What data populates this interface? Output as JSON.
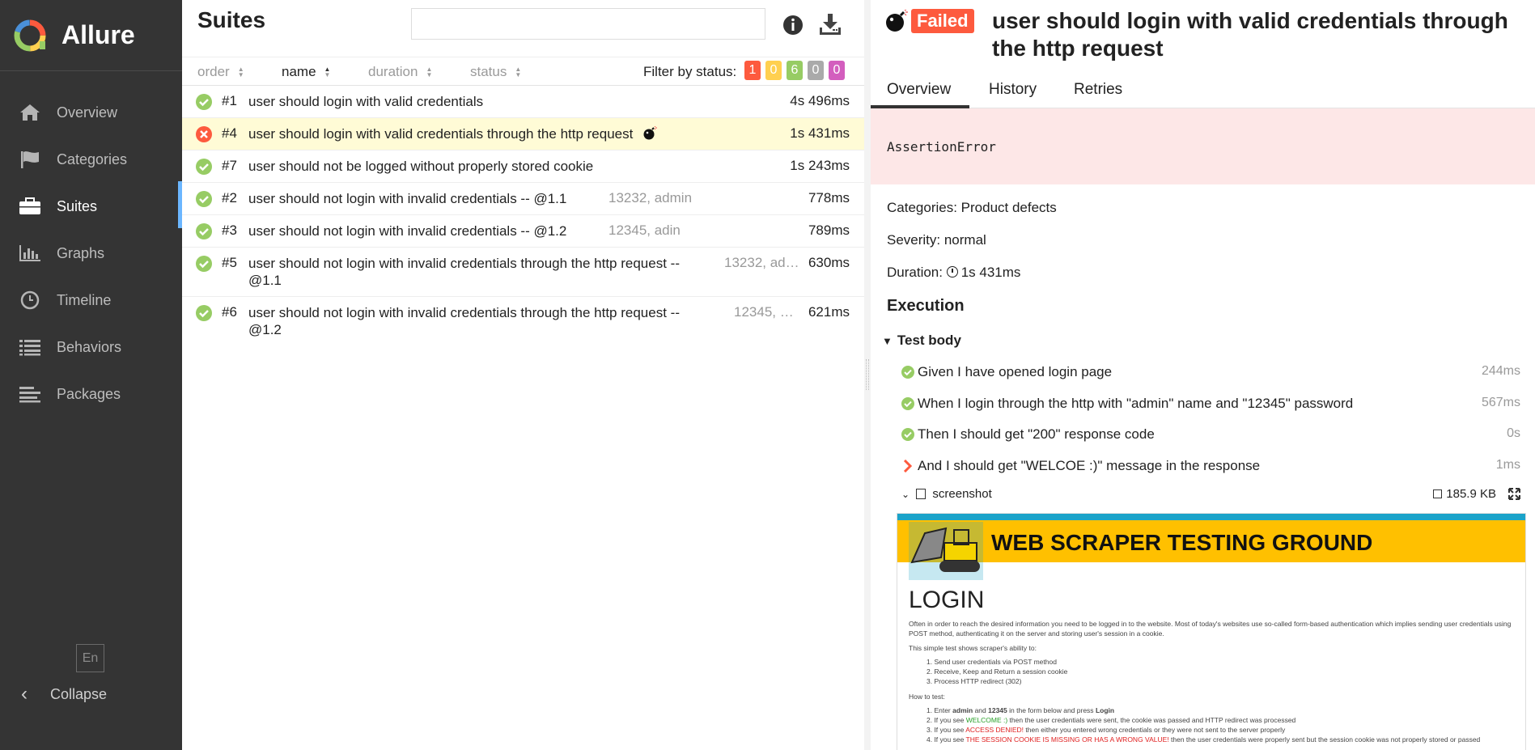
{
  "app": {
    "name": "Allure",
    "lang": "En",
    "collapse_label": "Collapse"
  },
  "sidebar": {
    "items": [
      {
        "label": "Overview",
        "icon": "home-icon"
      },
      {
        "label": "Categories",
        "icon": "flag-icon"
      },
      {
        "label": "Suites",
        "icon": "briefcase-icon",
        "active": true
      },
      {
        "label": "Graphs",
        "icon": "bar-chart-icon"
      },
      {
        "label": "Timeline",
        "icon": "clock-icon"
      },
      {
        "label": "Behaviors",
        "icon": "list-icon"
      },
      {
        "label": "Packages",
        "icon": "align-left-icon"
      }
    ]
  },
  "suites": {
    "title": "Suites",
    "search": {
      "value": "",
      "placeholder": ""
    },
    "sort": {
      "order": "order",
      "name": "name",
      "duration": "duration",
      "status": "status"
    },
    "filter_label": "Filter by status:",
    "status_counts": [
      {
        "count": "1",
        "color": "#fd5a3e",
        "status": "failed"
      },
      {
        "count": "0",
        "color": "#ffd050",
        "status": "broken"
      },
      {
        "count": "6",
        "color": "#97cc64",
        "status": "passed"
      },
      {
        "count": "0",
        "color": "#aaaaaa",
        "status": "skipped"
      },
      {
        "count": "0",
        "color": "#d35ebe",
        "status": "unknown"
      }
    ],
    "rows": [
      {
        "status": "passed",
        "num": "#1",
        "title": "user should login with valid credentials",
        "params": "",
        "duration": "4s 496ms"
      },
      {
        "status": "failed",
        "num": "#4",
        "title": "user should login with valid credentials through the http request",
        "params": "",
        "duration": "1s 431ms",
        "flaky": true
      },
      {
        "status": "passed",
        "num": "#7",
        "title": "user should not be logged without properly stored cookie",
        "params": "",
        "duration": "1s 243ms"
      },
      {
        "status": "passed",
        "num": "#2",
        "title": "user should not login with invalid credentials -- @1.1",
        "params": "13232, admin",
        "duration": "778ms"
      },
      {
        "status": "passed",
        "num": "#3",
        "title": "user should not login with invalid credentials -- @1.2",
        "params": "12345, adin",
        "duration": "789ms"
      },
      {
        "status": "passed",
        "num": "#5",
        "title": "user should not login with invalid credentials through the http request -- @1.1",
        "params": "13232, ad…",
        "duration": "630ms"
      },
      {
        "status": "passed",
        "num": "#6",
        "title": "user should not login with invalid credentials through the http request -- @1.2",
        "params": "12345, …",
        "duration": "621ms"
      }
    ]
  },
  "detail": {
    "status_label": "Failed",
    "title": "user should login with valid credentials through the http request",
    "tabs": [
      "Overview",
      "History",
      "Retries"
    ],
    "error": "AssertionError",
    "categories": "Categories: Product defects",
    "severity": "Severity: normal",
    "duration_label": "Duration:",
    "duration": "1s 431ms",
    "execution_title": "Execution",
    "test_body_label": "Test body",
    "steps": [
      {
        "status": "passed",
        "text": "Given I have opened login page",
        "duration": "244ms"
      },
      {
        "status": "passed",
        "text": "When I login through the http with \"admin\" name and \"12345\" password",
        "duration": "567ms"
      },
      {
        "status": "passed",
        "text": "Then I should get \"200\" response code",
        "duration": "0s"
      },
      {
        "status": "failed",
        "text": "And I should get \"WELCOE :)\" message in the response",
        "duration": "1ms"
      }
    ],
    "attachment": {
      "name": "screenshot",
      "size": "185.9 KB"
    },
    "screenshot": {
      "banner": "WEB SCRAPER TESTING GROUND",
      "heading": "LOGIN",
      "para1": "Often in order to reach the desired information you need to be logged in to the website. Most of today's websites use so-called form-based authentication which implies sending user credentials using POST method, authenticating it on the server and storing user's session in a cookie.",
      "para2": "This simple test shows scraper's ability to:",
      "list1": [
        "1. Send user credentials via POST method",
        "2. Receive, Keep and Return a session cookie",
        "3. Process HTTP redirect (302)"
      ],
      "para3": "How to test:",
      "list2": {
        "i1_pre": "1. Enter",
        "i1_a": "admin",
        "i1_mid": "and",
        "i1_b": "12345",
        "i1_post": "in the form below and press",
        "i1_c": "Login",
        "i2_pre": "2. If you see",
        "i2_hl": "WELCOME :)",
        "i2_post": "then the user credentials were sent, the cookie was passed and HTTP redirect was processed",
        "i3_pre": "3. If you see",
        "i3_hl": "ACCESS DENIED!",
        "i3_post": "then either you entered wrong credentials or they were not sent to the server properly",
        "i4_pre": "4. If you see",
        "i4_hl": "THE SESSION COOKIE IS MISSING OR HAS A WRONG VALUE!",
        "i4_post": "then the user credentials were properly sent but the session cookie was not properly stored or passed"
      }
    }
  }
}
